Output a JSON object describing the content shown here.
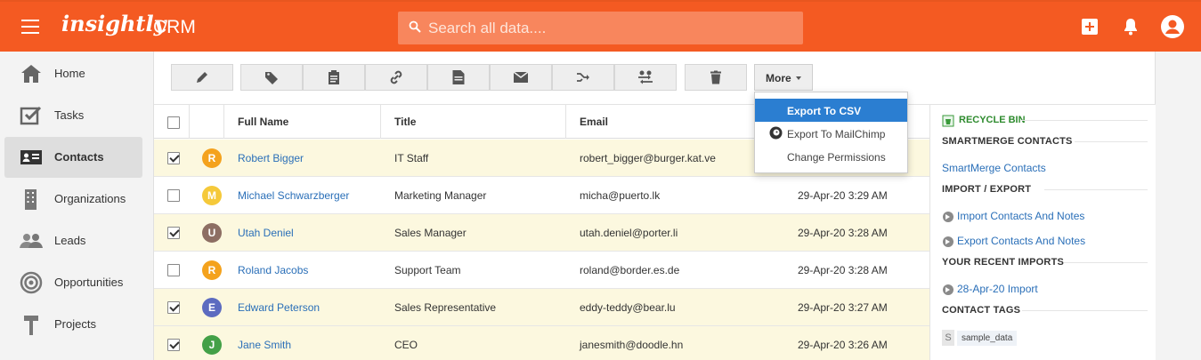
{
  "topbar": {
    "brand": "insightly",
    "app_name": "CRM",
    "search_placeholder": "Search all data....",
    "accent_color": "#f45a22",
    "icons": [
      "menu-icon",
      "search-icon",
      "add-icon",
      "bell-icon",
      "user-icon"
    ]
  },
  "nav": {
    "items": [
      {
        "label": "Home",
        "icon": "home-icon"
      },
      {
        "label": "Tasks",
        "icon": "tasks-icon"
      },
      {
        "label": "Contacts",
        "icon": "contacts-icon",
        "active": true
      },
      {
        "label": "Organizations",
        "icon": "organizations-icon"
      },
      {
        "label": "Leads",
        "icon": "leads-icon"
      },
      {
        "label": "Opportunities",
        "icon": "opportunities-icon"
      },
      {
        "label": "Projects",
        "icon": "projects-icon"
      }
    ]
  },
  "toolbar": {
    "buttons": [
      "edit-icon",
      "tag-icon",
      "clipboard-icon",
      "link-icon",
      "document-icon",
      "email-icon",
      "merge-icon",
      "transfer-icon",
      "delete-icon"
    ],
    "more_label": "More"
  },
  "more_menu": {
    "items": [
      {
        "label": "Export To CSV",
        "active": true
      },
      {
        "label": "Export To MailChimp",
        "icon": "mailchimp-icon"
      },
      {
        "label": "Change Permissions"
      }
    ]
  },
  "table": {
    "columns": [
      "Full Name",
      "Title",
      "Email"
    ],
    "rows": [
      {
        "initial": "R",
        "color": "#f4a21d",
        "name": "Robert Bigger",
        "title": "IT Staff",
        "email": "robert_bigger@burger.kat.ve",
        "date": "",
        "checked": true
      },
      {
        "initial": "M",
        "color": "#f5c93a",
        "name": "Michael Schwarzberger",
        "title": "Marketing Manager",
        "email": "micha@puerto.lk",
        "date": "29-Apr-20 3:29 AM",
        "checked": false
      },
      {
        "initial": "U",
        "color": "#8d6e63",
        "name": "Utah Deniel",
        "title": "Sales Manager",
        "email": "utah.deniel@porter.li",
        "date": "29-Apr-20 3:28 AM",
        "checked": true
      },
      {
        "initial": "R",
        "color": "#f4a21d",
        "name": "Roland Jacobs",
        "title": "Support Team",
        "email": "roland@border.es.de",
        "date": "29-Apr-20 3:28 AM",
        "checked": false
      },
      {
        "initial": "E",
        "color": "#5c6bc0",
        "name": "Edward Peterson",
        "title": "Sales Representative",
        "email": "eddy-teddy@bear.lu",
        "date": "29-Apr-20 3:27 AM",
        "checked": true
      },
      {
        "initial": "J",
        "color": "#43a047",
        "name": "Jane Smith",
        "title": "CEO",
        "email": "janesmith@doodle.hn",
        "date": "29-Apr-20 3:26 AM",
        "checked": true
      }
    ]
  },
  "right_panel": {
    "recycle_bin": "RECYCLE BIN",
    "smartmerge_heading": "SMARTMERGE CONTACTS",
    "smartmerge_link": "SmartMerge Contacts",
    "import_export_heading": "IMPORT / EXPORT",
    "import_link": "Import Contacts And Notes",
    "export_link": "Export Contacts And Notes",
    "recent_imports_heading": "YOUR RECENT IMPORTS",
    "recent_import_link": "28-Apr-20 Import",
    "tags_heading": "CONTACT TAGS",
    "tag_prefix": "S",
    "tag": "sample_data"
  }
}
